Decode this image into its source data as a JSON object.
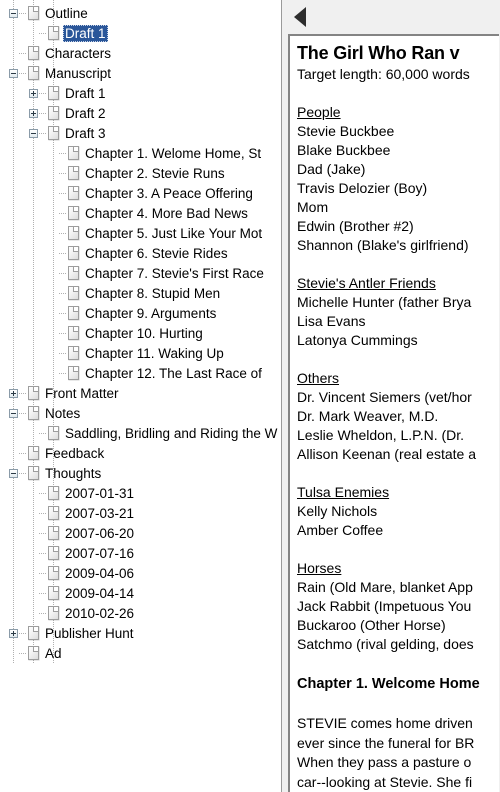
{
  "window": {
    "background_color": "#f0f0f0",
    "selection_color": "#2a5699"
  },
  "tree": {
    "name": "binder-outline-tree",
    "items": [
      {
        "label": "Outline",
        "depth": 0,
        "expander": "minus",
        "selected": false
      },
      {
        "label": "Draft 1",
        "depth": 1,
        "expander": "none",
        "selected": true
      },
      {
        "label": "Characters",
        "depth": 0,
        "expander": "none",
        "selected": false
      },
      {
        "label": "Manuscript",
        "depth": 0,
        "expander": "minus",
        "selected": false
      },
      {
        "label": "Draft 1",
        "depth": 1,
        "expander": "plus",
        "selected": false
      },
      {
        "label": "Draft 2",
        "depth": 1,
        "expander": "plus",
        "selected": false
      },
      {
        "label": "Draft 3",
        "depth": 1,
        "expander": "minus",
        "selected": false
      },
      {
        "label": "Chapter 1. Welome Home, St",
        "depth": 2,
        "expander": "none",
        "selected": false
      },
      {
        "label": "Chapter 2. Stevie Runs",
        "depth": 2,
        "expander": "none",
        "selected": false
      },
      {
        "label": "Chapter 3. A Peace Offering",
        "depth": 2,
        "expander": "none",
        "selected": false
      },
      {
        "label": "Chapter 4. More Bad News",
        "depth": 2,
        "expander": "none",
        "selected": false
      },
      {
        "label": "Chapter 5. Just Like Your Mot",
        "depth": 2,
        "expander": "none",
        "selected": false
      },
      {
        "label": "Chapter 6. Stevie Rides",
        "depth": 2,
        "expander": "none",
        "selected": false
      },
      {
        "label": "Chapter 7. Stevie's First Race",
        "depth": 2,
        "expander": "none",
        "selected": false
      },
      {
        "label": "Chapter 8. Stupid Men",
        "depth": 2,
        "expander": "none",
        "selected": false
      },
      {
        "label": "Chapter 9. Arguments",
        "depth": 2,
        "expander": "none",
        "selected": false
      },
      {
        "label": "Chapter 10. Hurting",
        "depth": 2,
        "expander": "none",
        "selected": false
      },
      {
        "label": "Chapter 11. Waking Up",
        "depth": 2,
        "expander": "none",
        "selected": false
      },
      {
        "label": "Chapter 12. The Last Race of",
        "depth": 2,
        "expander": "none",
        "selected": false
      },
      {
        "label": "Front Matter",
        "depth": 0,
        "expander": "plus",
        "selected": false
      },
      {
        "label": "Notes",
        "depth": 0,
        "expander": "minus",
        "selected": false
      },
      {
        "label": "Saddling, Bridling and Riding the W",
        "depth": 1,
        "expander": "none",
        "selected": false
      },
      {
        "label": "Feedback",
        "depth": 0,
        "expander": "none",
        "selected": false
      },
      {
        "label": "Thoughts",
        "depth": 0,
        "expander": "minus",
        "selected": false
      },
      {
        "label": "2007-01-31",
        "depth": 1,
        "expander": "none",
        "selected": false
      },
      {
        "label": "2007-03-21",
        "depth": 1,
        "expander": "none",
        "selected": false
      },
      {
        "label": "2007-06-20",
        "depth": 1,
        "expander": "none",
        "selected": false
      },
      {
        "label": "2007-07-16",
        "depth": 1,
        "expander": "none",
        "selected": false
      },
      {
        "label": "2009-04-06",
        "depth": 1,
        "expander": "none",
        "selected": false
      },
      {
        "label": "2009-04-14",
        "depth": 1,
        "expander": "none",
        "selected": false
      },
      {
        "label": "2010-02-26",
        "depth": 1,
        "expander": "none",
        "selected": false
      },
      {
        "label": "Publisher Hunt",
        "depth": 0,
        "expander": "plus",
        "selected": false
      },
      {
        "label": "Ad",
        "depth": 0,
        "expander": "none",
        "selected": false
      }
    ]
  },
  "right_pane": {
    "collapse_button": {
      "icon": "triangle-left-icon",
      "label": ""
    },
    "document": {
      "title": "The Girl Who Ran v",
      "meta": "Target length: 60,000 words",
      "blocks": [
        {
          "type": "blank"
        },
        {
          "type": "heading",
          "text": "People"
        },
        {
          "type": "line",
          "text": "Stevie Buckbee"
        },
        {
          "type": "line",
          "text": "Blake Buckbee"
        },
        {
          "type": "line",
          "text": "Dad (Jake)"
        },
        {
          "type": "line",
          "text": "Travis Delozier (Boy)"
        },
        {
          "type": "line",
          "text": "Mom"
        },
        {
          "type": "line",
          "text": "Edwin (Brother #2)"
        },
        {
          "type": "line",
          "text": "Shannon (Blake's girlfriend)"
        },
        {
          "type": "blank"
        },
        {
          "type": "heading",
          "text": "Stevie's Antler Friends"
        },
        {
          "type": "line",
          "text": "Michelle Hunter (father Brya"
        },
        {
          "type": "line",
          "text": "Lisa Evans"
        },
        {
          "type": "line",
          "text": "Latonya Cummings"
        },
        {
          "type": "blank"
        },
        {
          "type": "heading",
          "text": "Others"
        },
        {
          "type": "line",
          "text": "Dr. Vincent Siemers (vet/hor"
        },
        {
          "type": "line",
          "text": "Dr. Mark Weaver, M.D."
        },
        {
          "type": "line",
          "text": "Leslie Wheldon, L.P.N. (Dr. "
        },
        {
          "type": "line",
          "text": "Allison Keenan (real estate a"
        },
        {
          "type": "blank"
        },
        {
          "type": "heading",
          "text": "Tulsa Enemies"
        },
        {
          "type": "line",
          "text": "Kelly Nichols"
        },
        {
          "type": "line",
          "text": "Amber Coffee"
        },
        {
          "type": "blank"
        },
        {
          "type": "heading",
          "text": "Horses"
        },
        {
          "type": "line",
          "text": "Rain (Old Mare, blanket App"
        },
        {
          "type": "line",
          "text": "Jack Rabbit (Impetuous You"
        },
        {
          "type": "line",
          "text": "Buckaroo (Other Horse)"
        },
        {
          "type": "line",
          "text": "Satchmo (rival gelding, does"
        },
        {
          "type": "blank"
        },
        {
          "type": "chapter",
          "text": "Chapter 1. Welcome Home"
        },
        {
          "type": "blank"
        },
        {
          "type": "para",
          "text": "STEVIE comes home driven"
        },
        {
          "type": "para",
          "text": "ever since the funeral for BR"
        },
        {
          "type": "para",
          "text": "When they pass a pasture o"
        },
        {
          "type": "para",
          "text": "car--looking at Stevie. She fi"
        }
      ]
    }
  }
}
